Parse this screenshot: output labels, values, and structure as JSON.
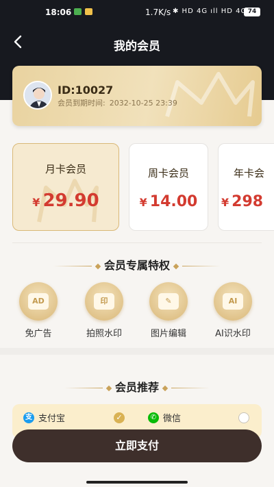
{
  "status_bar": {
    "time": "18:06",
    "speed": "1.7K/s",
    "network_icons": "✱ HD 4G ıll HD 4G ıll",
    "battery": "74"
  },
  "header": {
    "back_icon": "chevron-left-icon",
    "title": "我的会员"
  },
  "member": {
    "id": "ID:10027",
    "expire_label": "会员到期时间:",
    "expire_value": "2032-10-25 23:39"
  },
  "plans": [
    {
      "name": "月卡会员",
      "currency": "¥",
      "price": "29.90",
      "selected": true
    },
    {
      "name": "周卡会员",
      "currency": "¥",
      "price": "14.00",
      "selected": false
    },
    {
      "name": "年卡会",
      "currency": "¥",
      "price": "298",
      "selected": false
    }
  ],
  "privileges": {
    "title": "会员专属特权",
    "items": [
      {
        "label": "免广告",
        "icon_text": "AD",
        "icon": "no-ads-icon"
      },
      {
        "label": "拍照水印",
        "icon_text": "印",
        "icon": "camera-watermark-icon"
      },
      {
        "label": "图片编辑",
        "icon_text": "✎",
        "icon": "image-edit-icon"
      },
      {
        "label": "AI识水印",
        "icon_text": "AI",
        "icon": "ai-watermark-icon"
      }
    ]
  },
  "recommend": {
    "title": "会员推荐"
  },
  "payment": {
    "alipay_label": "支付宝",
    "alipay_badge": "支",
    "wechat_label": "微信",
    "wechat_badge": "✆",
    "alipay_selected": true,
    "pay_button": "立即支付"
  },
  "colors": {
    "header_bg": "#17191f",
    "gold": "#d9b877",
    "price_red": "#d33b30",
    "button_bg": "#3e2f2b",
    "alipay_blue": "#1a9cef",
    "wechat_green": "#09bb07"
  }
}
